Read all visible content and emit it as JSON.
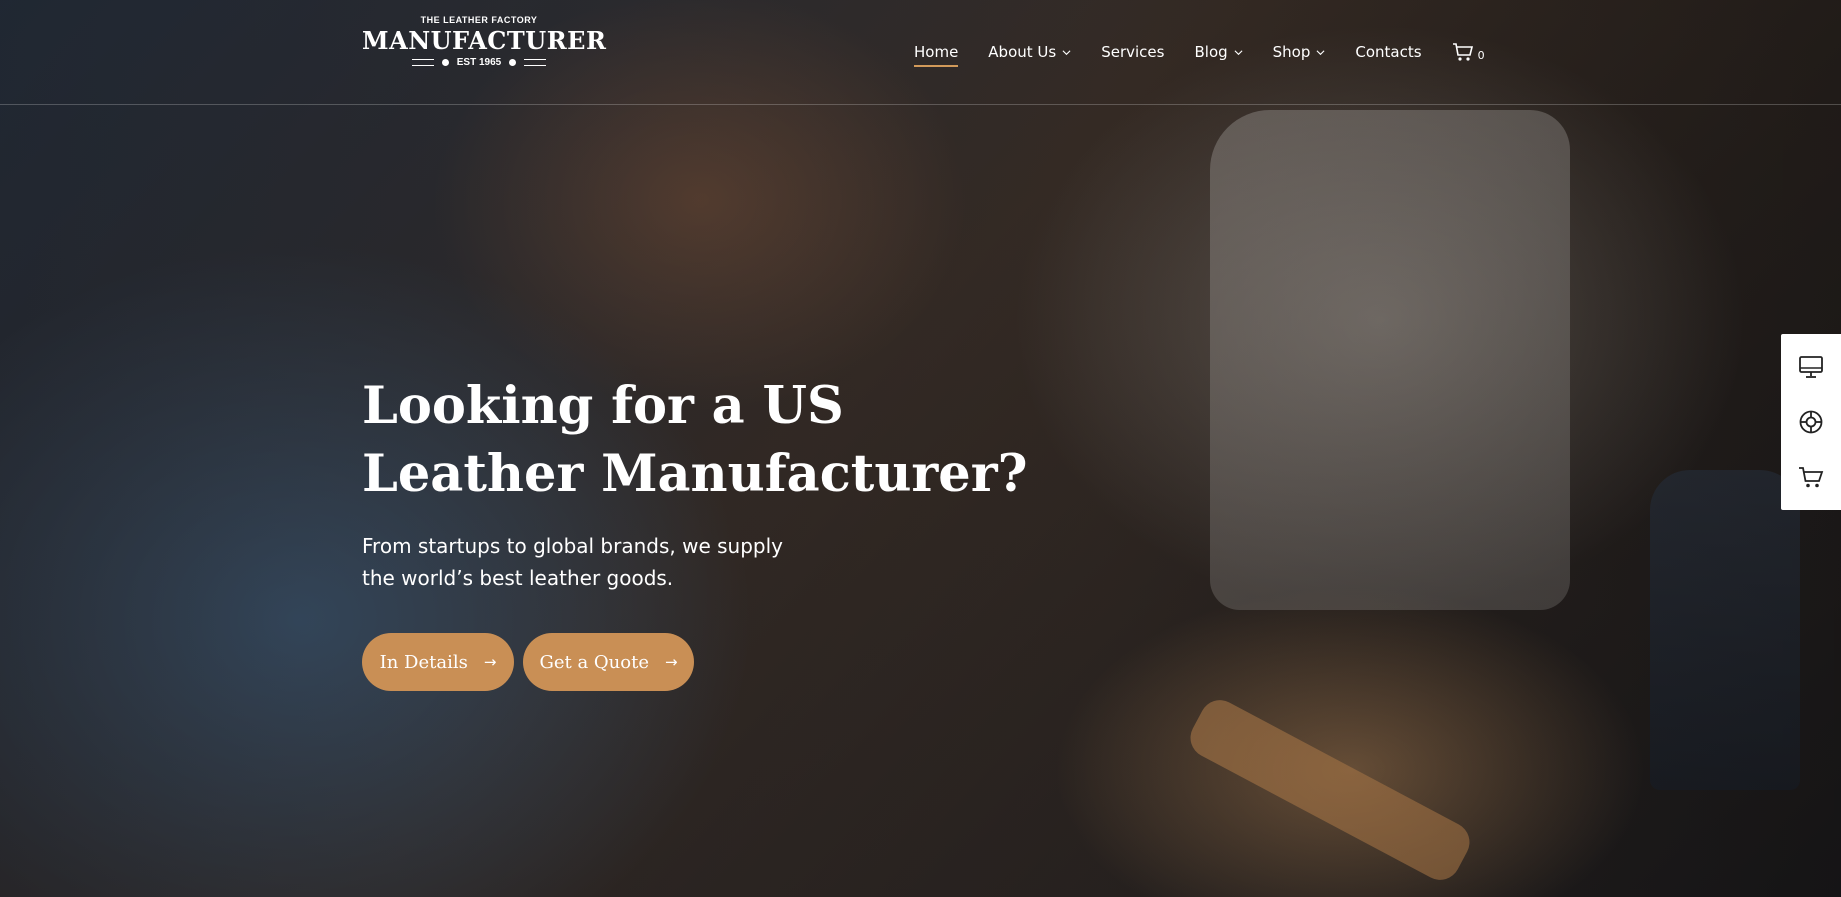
{
  "brand": {
    "tagline": "THE LEATHER FACTORY",
    "name": "MANUFACTURER",
    "established": "EST 1965"
  },
  "nav": {
    "items": [
      {
        "label": "Home",
        "active": true,
        "has_dropdown": false
      },
      {
        "label": "About Us",
        "active": false,
        "has_dropdown": true
      },
      {
        "label": "Services",
        "active": false,
        "has_dropdown": false
      },
      {
        "label": "Blog",
        "active": false,
        "has_dropdown": true
      },
      {
        "label": "Shop",
        "active": false,
        "has_dropdown": true
      },
      {
        "label": "Contacts",
        "active": false,
        "has_dropdown": false
      }
    ],
    "cart_count": "0"
  },
  "hero": {
    "headline_line1": "Looking for a US",
    "headline_line2": "Leather Manufacturer?",
    "subtitle_line1": "From startups to global brands, we supply",
    "subtitle_line2": "the world’s best leather goods.",
    "buttons": {
      "details_label": "In Details",
      "quote_label": "Get a Quote"
    }
  },
  "side_panel": {
    "icons": [
      "monitor-icon",
      "lifebuoy-icon",
      "cart-icon"
    ]
  },
  "colors": {
    "accent": "#c98f55",
    "nav_underline": "#d29a5a",
    "text": "#ffffff"
  }
}
